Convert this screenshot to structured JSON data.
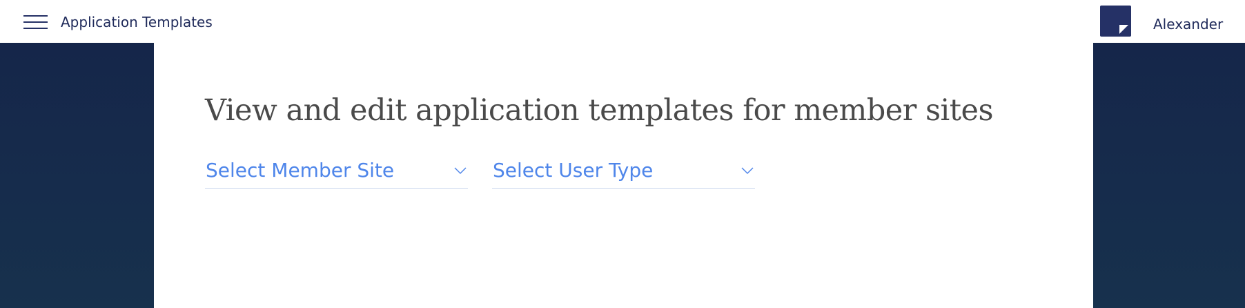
{
  "header": {
    "menu_icon": "hamburger-menu-icon",
    "title": "Application Templates",
    "user_name": "Alexander",
    "avatar_icon": "user-avatar"
  },
  "main": {
    "heading": "View and edit application templates for member sites",
    "selects": [
      {
        "label": "Select Member Site",
        "icon": "chevron-down-icon"
      },
      {
        "label": "Select User Type",
        "icon": "chevron-down-icon"
      }
    ]
  },
  "colors": {
    "header_text": "#1f2a5a",
    "accent_blue": "#4f86ea",
    "sidebar_background": "#15264a",
    "heading_text": "#4a4a4a"
  }
}
